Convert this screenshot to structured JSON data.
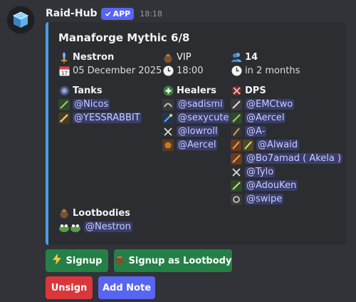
{
  "message": {
    "author": "Raid-Hub",
    "app_badge": "APP",
    "timestamp": "18:18"
  },
  "embed": {
    "accent_color": "#4b9ee8",
    "title": "Manaforge Mythic 6/8",
    "info": {
      "leader": "Nestron",
      "date": "05 December 2025",
      "loot_type": "VIP",
      "time": "18:00",
      "signup_count": "14",
      "relative_time": "in 2 months"
    },
    "tanks": {
      "title": "Tanks",
      "members": [
        "@Nicos",
        "@YESSRABBIT"
      ]
    },
    "healers": {
      "title": "Healers",
      "members": [
        "@sadismi",
        "@sexycute",
        "@lowroll",
        "@Aercel"
      ]
    },
    "dps": {
      "title": "DPS",
      "members": [
        "@EMCtwo",
        "@Aercel",
        "@A-",
        "@Alwaid",
        "@Bo7amad ( Akela )",
        "@Tylo",
        "@AdouKen",
        "@swipe"
      ]
    },
    "lootbodies": {
      "title": "Lootbodies",
      "members": [
        "@Nestron"
      ]
    }
  },
  "buttons": {
    "signup": "Signup",
    "signup_lootbody": "Signup as Lootbody",
    "unsign": "Unsign",
    "add_note": "Add Note"
  },
  "colors": {
    "background": "#313338",
    "embed_background": "#2b2d31",
    "green_button": "#248046",
    "red_button": "#da373c",
    "blurple": "#5865f2"
  }
}
